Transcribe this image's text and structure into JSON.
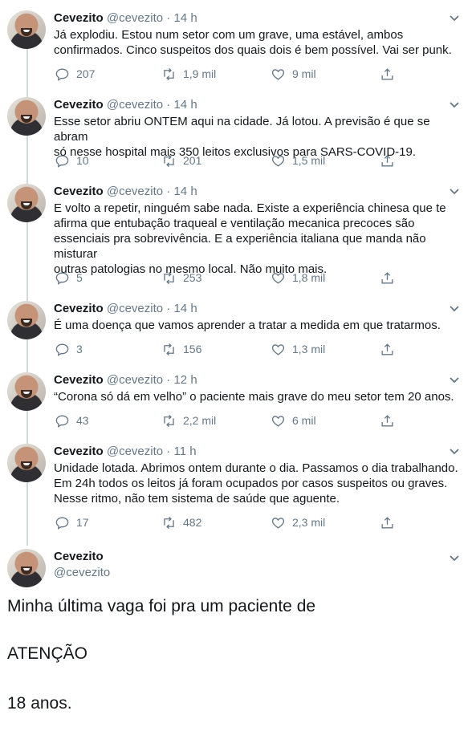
{
  "tweets": [
    {
      "name": "Cevezito",
      "handle": "@cevezito",
      "sep": "·",
      "time": "14 h",
      "text": "Já explodiu. Estou num setor com um grave, uma estável, ambos\nconfirmados. Cinco suspeitos dos quais dois é bem possível. Vai ser punk.",
      "replies": "207",
      "retweets": "1,9 mil",
      "likes": "9 mil"
    },
    {
      "name": "Cevezito",
      "handle": "@cevezito",
      "sep": "·",
      "time": "14 h",
      "text": "Esse setor abriu ONTEM aqui na cidade. Já lotou. A previsão é que se abram\nsó nesse hospital mais 350 leitos exclusivos para SARS-COVID-19.",
      "replies": "10",
      "retweets": "201",
      "likes": "1,5 mil"
    },
    {
      "name": "Cevezito",
      "handle": "@cevezito",
      "sep": "·",
      "time": "14 h",
      "text": "E volto a repetir, ninguém sabe nada. Existe a experiência chinesa que te\nafirma que entubação traqueal e ventilação mecanica precoces são\nessenciais pra sobrevivência. E a experiência italiana que manda não misturar\noutras patologias no mesmo local. Não muito mais.",
      "replies": "5",
      "retweets": "253",
      "likes": "1,8 mil"
    },
    {
      "name": "Cevezito",
      "handle": "@cevezito",
      "sep": "·",
      "time": "14 h",
      "text": "É uma doença que vamos aprender a tratar a medida em que tratarmos.",
      "replies": "3",
      "retweets": "156",
      "likes": "1,3 mil"
    },
    {
      "name": "Cevezito",
      "handle": "@cevezito",
      "sep": "·",
      "time": "12 h",
      "text": "“Corona só dá em velho” o paciente mais grave do meu setor tem 20 anos.",
      "replies": "43",
      "retweets": "2,2 mil",
      "likes": "6 mil"
    },
    {
      "name": "Cevezito",
      "handle": "@cevezito",
      "sep": "·",
      "time": "11 h",
      "text": "Unidade lotada. Abrimos ontem durante o dia. Passamos o dia trabalhando.\nEm 24h todos os leitos já foram ocupados por casos suspeitos ou graves.\nNesse ritmo, não tem sistema de saúde que aguente.",
      "replies": "17",
      "retweets": "482",
      "likes": "2,3 mil"
    }
  ],
  "last_tweet": {
    "name": "Cevezito",
    "handle": "@cevezito",
    "line1": "Minha última vaga foi pra um paciente de",
    "line2": "ATENÇÃO",
    "line3": "18 anos."
  },
  "icons": {
    "reply": "reply-icon",
    "retweet": "retweet-icon",
    "like": "heart-icon",
    "share": "share-icon",
    "menu": "chevron-down-icon"
  },
  "colors": {
    "text": "#14171a",
    "secondary": "#657786",
    "thread_line": "#cfd9de"
  }
}
